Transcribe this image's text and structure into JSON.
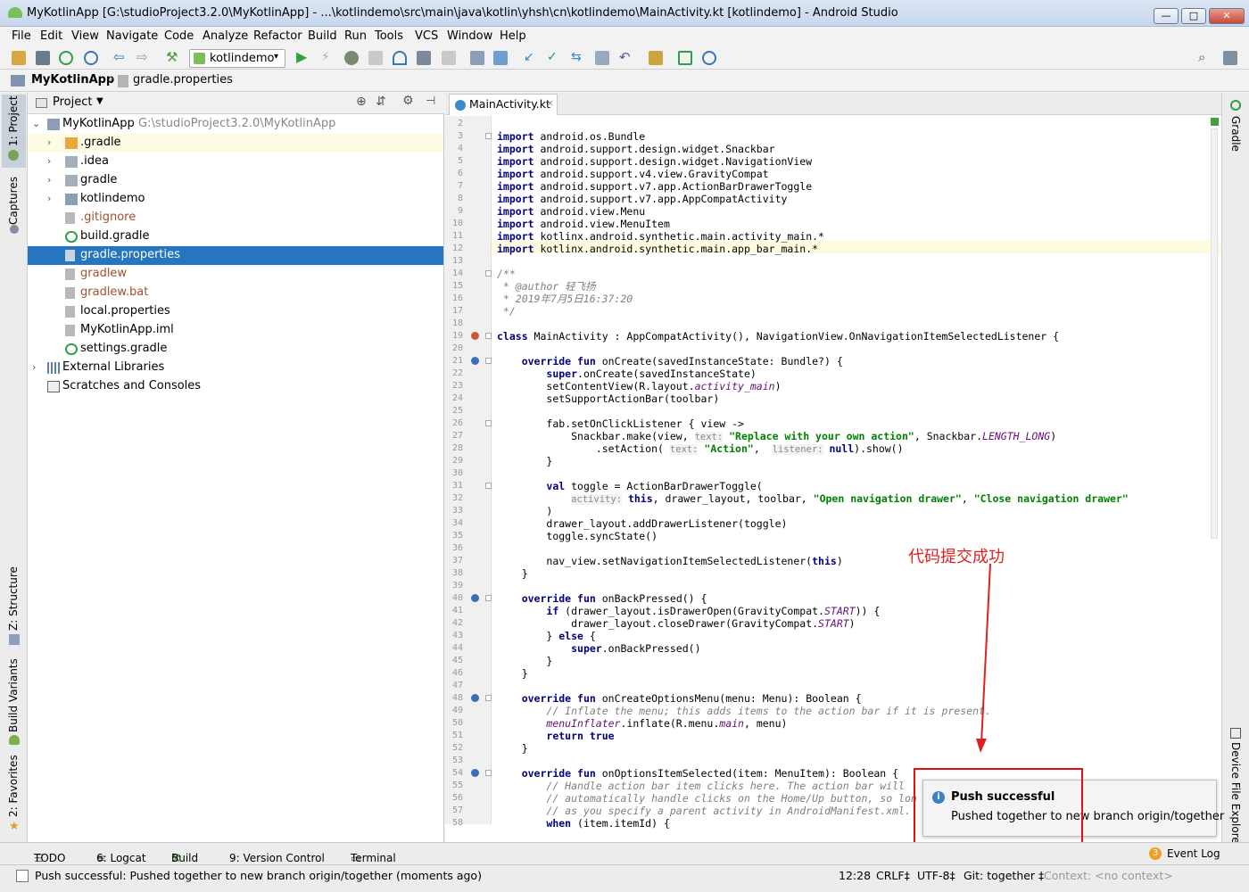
{
  "window": {
    "title": "MyKotlinApp [G:\\studioProject3.2.0\\MyKotlinApp] - ...\\kotlindemo\\src\\main\\java\\kotlin\\yhsh\\cn\\kotlindemo\\MainActivity.kt [kotlindemo] - Android Studio",
    "min": "—",
    "max": "□",
    "close": "✕"
  },
  "menu": [
    "File",
    "Edit",
    "View",
    "Navigate",
    "Code",
    "Analyze",
    "Refactor",
    "Build",
    "Run",
    "Tools",
    "VCS",
    "Window",
    "Help"
  ],
  "toolbar": {
    "run_config": "kotlindemo"
  },
  "breadcrumb": {
    "project": "MyKotlinApp",
    "file": "gradle.properties"
  },
  "project_panel": {
    "header": "Project",
    "items": [
      {
        "name": "MyKotlinApp",
        "path": "G:\\studioProject3.2.0\\MyKotlinApp",
        "icon": "module-folder-icon"
      },
      {
        "name": ".gradle",
        "icon": "folder-icon"
      },
      {
        "name": ".idea",
        "icon": "folder-icon"
      },
      {
        "name": "gradle",
        "icon": "folder-icon"
      },
      {
        "name": "kotlindemo",
        "icon": "folder-icon"
      },
      {
        "name": ".gitignore",
        "icon": "file-icon"
      },
      {
        "name": "build.gradle",
        "icon": "gradle-icon"
      },
      {
        "name": "gradle.properties",
        "icon": "file-icon"
      },
      {
        "name": "gradlew",
        "icon": "file-icon"
      },
      {
        "name": "gradlew.bat",
        "icon": "file-icon"
      },
      {
        "name": "local.properties",
        "icon": "file-icon"
      },
      {
        "name": "MyKotlinApp.iml",
        "icon": "file-icon"
      },
      {
        "name": "settings.gradle",
        "icon": "gradle-icon"
      },
      {
        "name": "External Libraries",
        "icon": "library-icon"
      },
      {
        "name": "Scratches and Consoles",
        "icon": "scratch-icon"
      }
    ]
  },
  "left_tabs": {
    "project": "1: Project",
    "captures": "Captures",
    "structure": "Z: Structure",
    "build_variants": "Build Variants",
    "favorites": "2: Favorites"
  },
  "right_tabs": {
    "gradle": "Gradle",
    "device_explorer": "Device File Explorer"
  },
  "editor": {
    "tab": "MainActivity.kt",
    "line_numbers": [
      "2",
      "3",
      "4",
      "5",
      "6",
      "7",
      "8",
      "9",
      "10",
      "11",
      "12",
      "13",
      "14",
      "15",
      "16",
      "17",
      "18",
      "19",
      "20",
      "21",
      "22",
      "23",
      "24",
      "25",
      "26",
      "27",
      "28",
      "29",
      "30",
      "31",
      "32",
      "33",
      "34",
      "35",
      "36",
      "37",
      "38",
      "39",
      "40",
      "41",
      "42",
      "43",
      "44",
      "45",
      "46",
      "47",
      "48",
      "49",
      "50",
      "51",
      "52",
      "53",
      "54",
      "55",
      "56",
      "57",
      "58"
    ],
    "imports": [
      "android.os.Bundle",
      "android.support.design.widget.Snackbar",
      "android.support.design.widget.NavigationView",
      "android.support.v4.view.GravityCompat",
      "android.support.v7.app.ActionBarDrawerToggle",
      "android.support.v7.app.AppCompatActivity",
      "android.view.Menu",
      "android.view.MenuItem",
      "kotlinx.android.synthetic.main.activity_main.*",
      "kotlinx.android.synthetic.main.app_bar_main.*"
    ],
    "kw": {
      "import": "import",
      "class": "class",
      "override": "override",
      "fun": "fun",
      "super": "super",
      "val": "val",
      "this": "this",
      "null": "null",
      "if": "if",
      "else": "else",
      "return": "return",
      "true": "true",
      "when": "when"
    },
    "doc": {
      "open": "/**",
      "author_tag": "@author",
      "author": " 轻飞扬",
      "date": " * 2019年7月5日16:37:20",
      "close": " */",
      "star": " * "
    },
    "class_decl": " MainActivity : AppCompatActivity(), NavigationView.OnNavigationItemSelectedListener {",
    "onCreate": " onCreate(savedInstanceState: Bundle?) {",
    "superOnCreate": ".onCreate(savedInstanceState)",
    "setContentView": "setContentView(R.layout.",
    "activity_main": "activity_main",
    "setSupport": "setSupportActionBar(toolbar)",
    "fab": "fab.setOnClickListener { view ->",
    "snack1": "Snackbar.make(view, ",
    "hint_text": "text:",
    "replace_str": "\"Replace with your own action\"",
    "snack2": ", Snackbar.",
    "length_long": "LENGTH_LONG",
    "setAction": ".setAction( ",
    "action_str": "\"Action\"",
    "hint_listener": "listener:",
    "show": ").show()",
    "close_brace": "}",
    "val_toggle": " toggle = ActionBarDrawerToggle(",
    "hint_activity": "activity:",
    "drawer_args": ", drawer_layout, toolbar, ",
    "open_str": "\"Open navigation drawer\"",
    "close_str": "\"Close navigation drawer\"",
    "rparen": ")",
    "addListener": "drawer_layout.addDrawerListener(toggle)",
    "syncState": "toggle.syncState()",
    "navview": "nav_view.setNavigationItemSelectedListener(",
    "onBack": " onBackPressed() {",
    "ifDrawer": " (drawer_layout.isDrawerOpen(GravityCompat.",
    "start": "START",
    "ifEnd": ")) {",
    "closeDrawer": "drawer_layout.closeDrawer(GravityCompat.",
    "elseLine": "} ",
    "superBack": ".onBackPressed()",
    "onCreateMenu": " onCreateOptionsMenu(menu: Menu): Boolean {",
    "inflateCm": "// Inflate the menu; this adds items to the action bar if it is present.",
    "menuInflater": "menuInflater",
    "inflate": ".inflate(R.menu.",
    "main": "main",
    "inflateEnd": ", menu)",
    "onItem": " onOptionsItemSelected(item: MenuItem): Boolean {",
    "cm55": "// Handle action bar item clicks here. The action bar will",
    "cm56": "// automatically handle clicks on the Home/Up button, so lon",
    "cm57": "// as you specify a parent activity in AndroidManifest.xml.",
    "when": " (item.itemId) {"
  },
  "annotation": "代码提交成功",
  "notification": {
    "title": "Push successful",
    "body": "Pushed together to new branch origin/together"
  },
  "tool_windows": [
    "TODO",
    "6: Logcat",
    "Build",
    "9: Version Control",
    "Terminal"
  ],
  "event_log": {
    "count": "3",
    "label": "Event Log"
  },
  "status": {
    "message": "Push successful: Pushed together to new branch origin/together (moments ago)",
    "position": "12:28",
    "line_sep": "CRLF‡",
    "encoding": "UTF-8‡",
    "git": "Git: together ‡",
    "context": "Context: <no context>"
  },
  "colors": {
    "accent": "#2675bf",
    "selection": "#2675bf",
    "annotation_red": "#e02020"
  }
}
